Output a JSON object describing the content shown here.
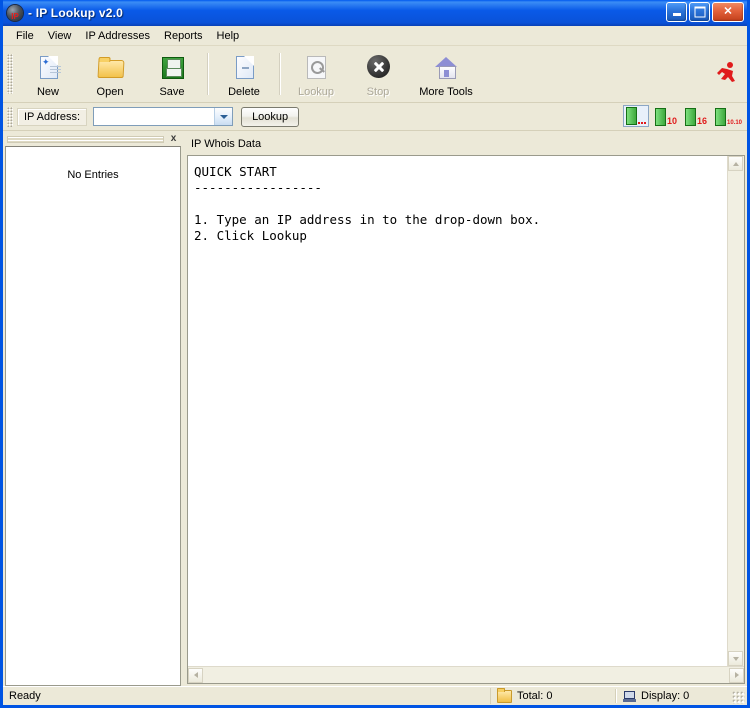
{
  "window": {
    "title": "- IP Lookup v2.0",
    "app_icon": "globe-ip-icon",
    "minimize_label": "Minimize",
    "maximize_label": "Maximize",
    "close_label": "Close"
  },
  "menubar": {
    "items": [
      {
        "label": "File"
      },
      {
        "label": "View"
      },
      {
        "label": "IP Addresses"
      },
      {
        "label": "Reports"
      },
      {
        "label": "Help"
      }
    ]
  },
  "toolbar": {
    "buttons": [
      {
        "label": "New",
        "icon": "new-document-icon",
        "enabled": true
      },
      {
        "label": "Open",
        "icon": "open-folder-icon",
        "enabled": true
      },
      {
        "label": "Save",
        "icon": "save-floppy-icon",
        "enabled": true
      },
      {
        "label": "Delete",
        "icon": "delete-document-icon",
        "enabled": true
      },
      {
        "label": "Lookup",
        "icon": "magnifier-icon",
        "enabled": false
      },
      {
        "label": "Stop",
        "icon": "stop-circle-icon",
        "enabled": false
      },
      {
        "label": "More Tools",
        "icon": "house-icon",
        "enabled": true
      }
    ],
    "runner_icon": "red-running-man-icon"
  },
  "addressbar": {
    "label": "IP Address:",
    "input_value": "",
    "input_placeholder": "",
    "dropdown_icon": "chevron-down-icon",
    "lookup_button": "Lookup",
    "status_icons": [
      {
        "name": "bar-dots-icon",
        "value": "",
        "selected": true
      },
      {
        "name": "bar-10-icon",
        "value": "10",
        "selected": false
      },
      {
        "name": "bar-16-icon",
        "value": "16",
        "selected": false
      },
      {
        "name": "bar-10-10-icon",
        "value": "10.10",
        "selected": false
      }
    ]
  },
  "leftpane": {
    "close_icon": "x",
    "empty_text": "No Entries"
  },
  "rightpane": {
    "title": "IP Whois Data",
    "text": "QUICK START\n-----------------\n\n1. Type an IP address in to the drop-down box.\n2. Click Lookup"
  },
  "statusbar": {
    "message": "Ready",
    "total_label": "Total: 0",
    "total_icon": "folder-icon",
    "display_label": "Display: 0",
    "display_icon": "monitor-icon"
  }
}
